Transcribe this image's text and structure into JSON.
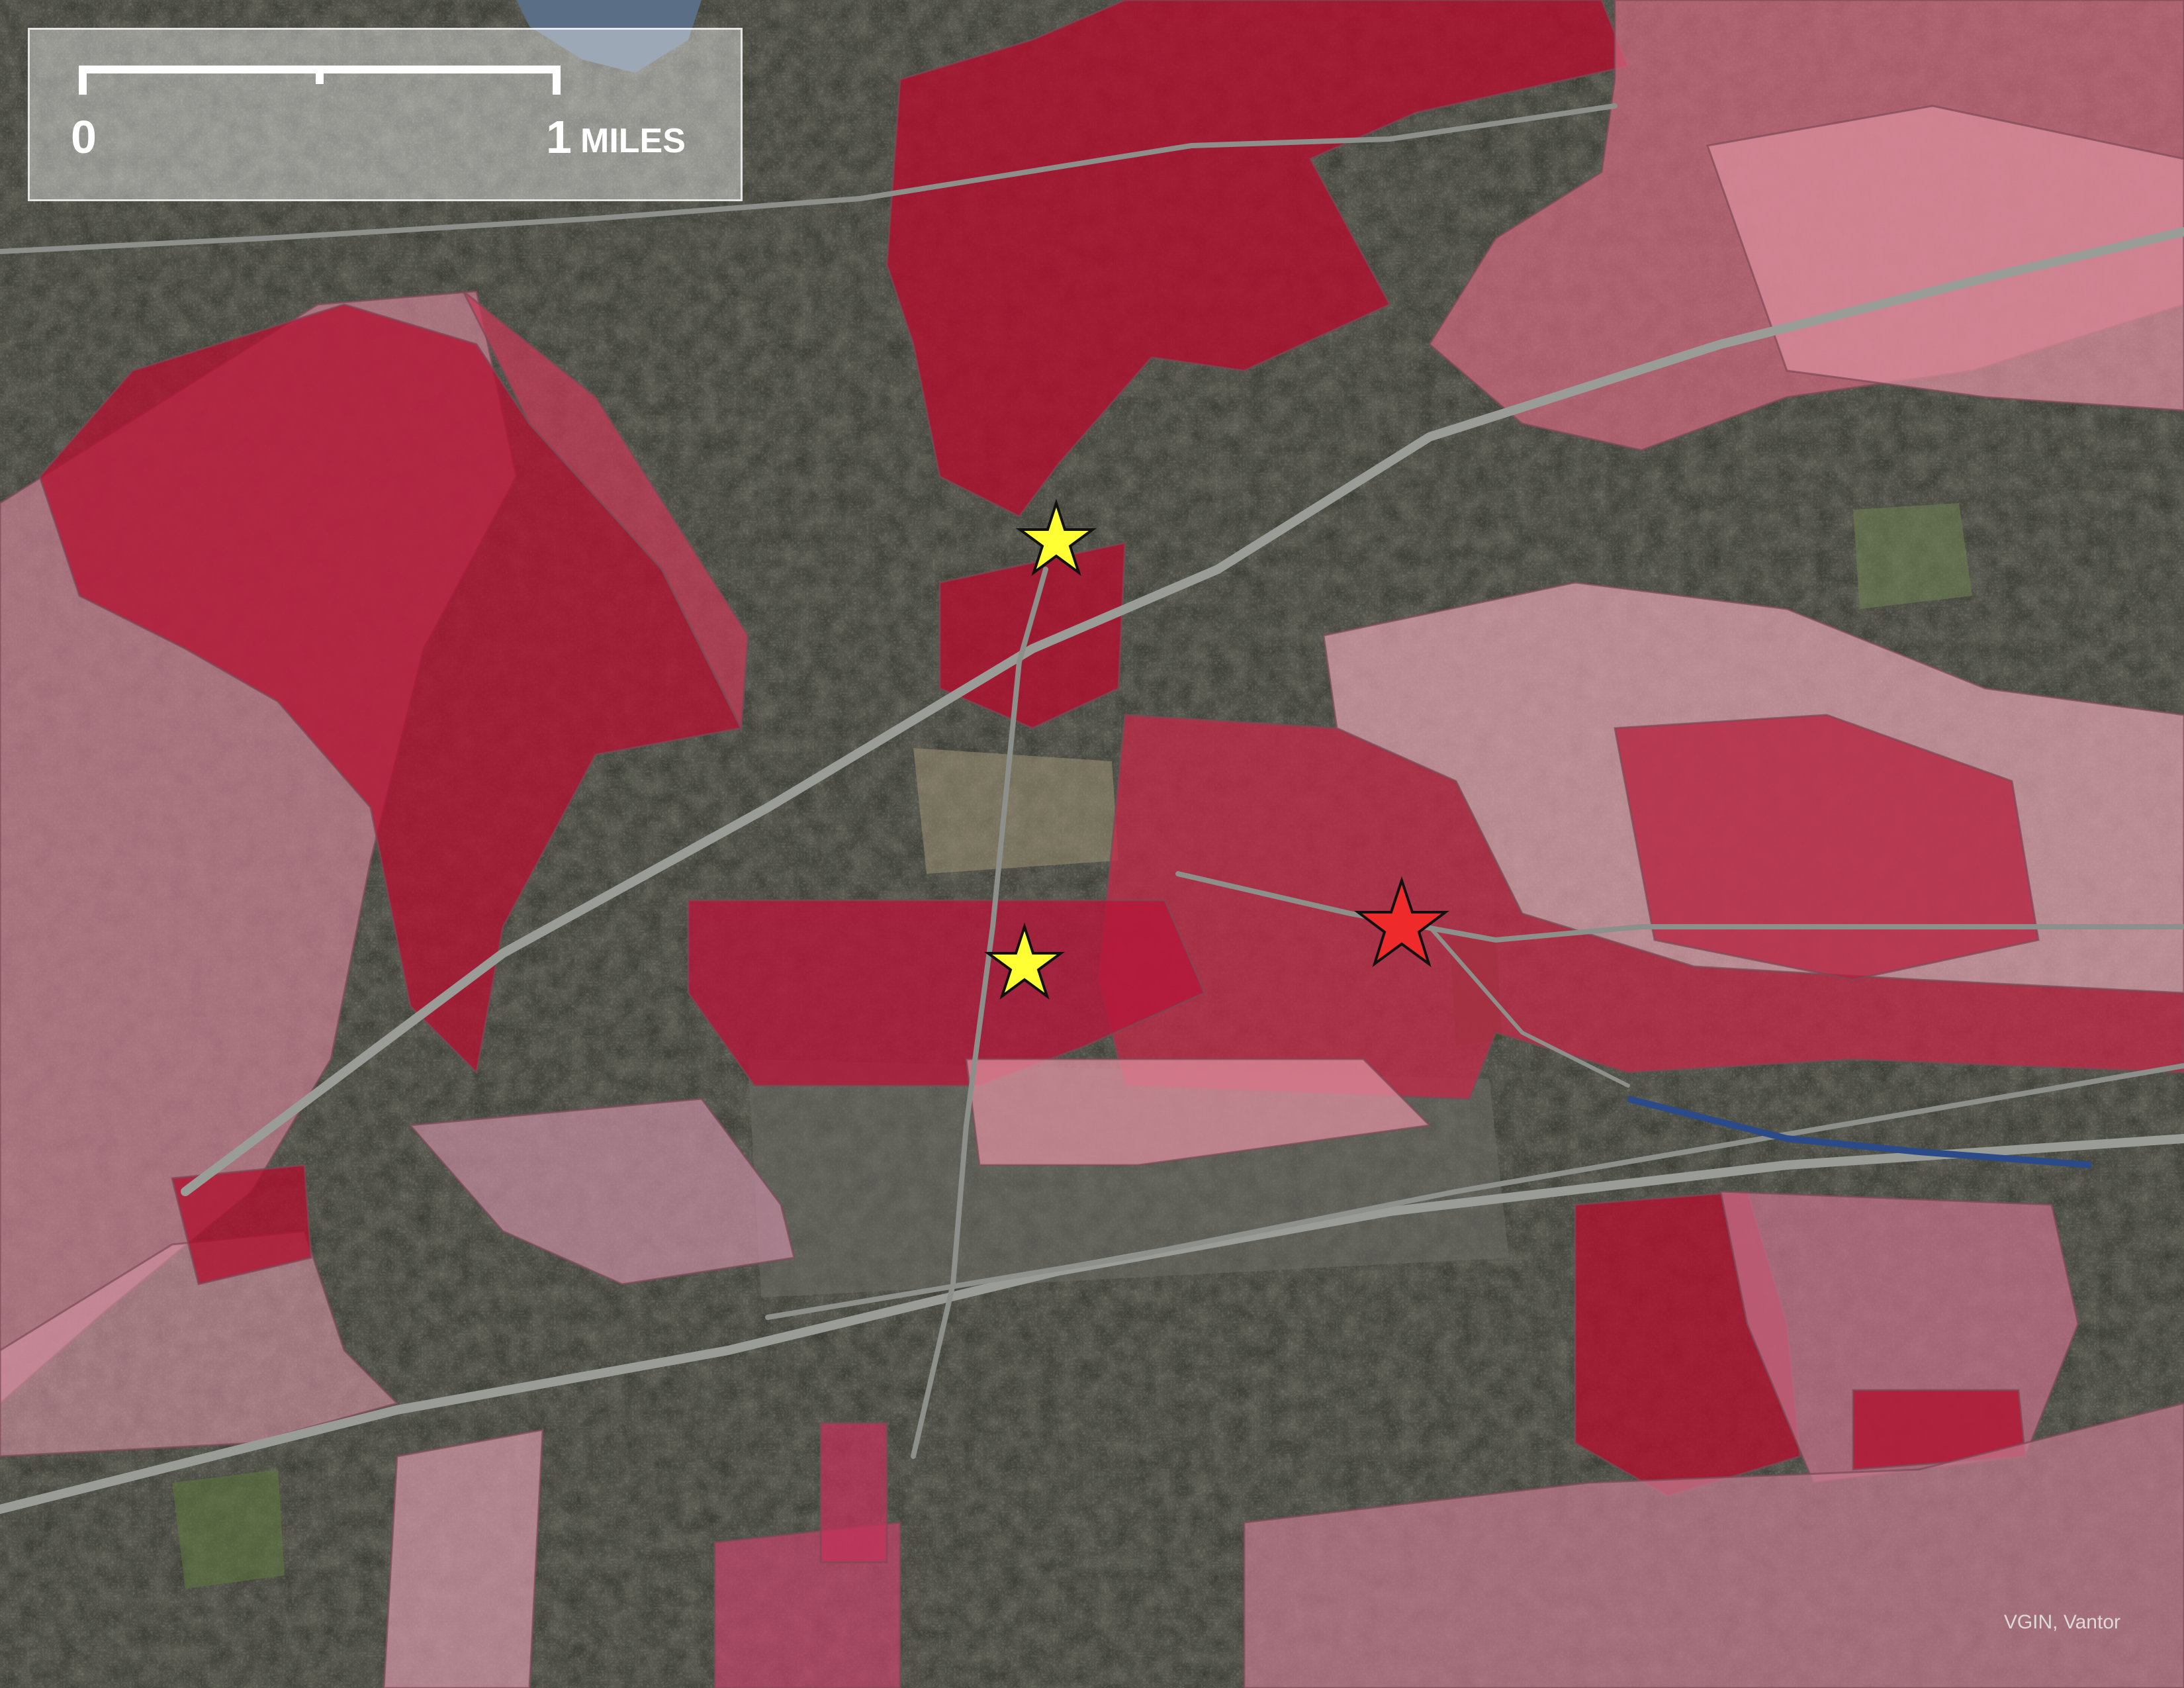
{
  "scale_bar": {
    "start_label": "0",
    "end_label": "1",
    "unit_label": "MILES",
    "color": "#ffffff"
  },
  "attribution": "VGIN, Vantor",
  "markers": [
    {
      "type": "star",
      "color": "#ffff33",
      "icon": "yellow-star-icon"
    },
    {
      "type": "star",
      "color": "#ffff33",
      "icon": "yellow-star-icon"
    },
    {
      "type": "star",
      "color": "#ee2a2a",
      "icon": "red-star-icon"
    }
  ],
  "choropleth_colors": {
    "darkest": "#b00d2a",
    "dark": "#c2253f",
    "medium": "#cc5064",
    "light": "#dc8c99",
    "lightest": "#e9b8c0",
    "mauve": "#c08898"
  },
  "basemap": "satellite imagery"
}
